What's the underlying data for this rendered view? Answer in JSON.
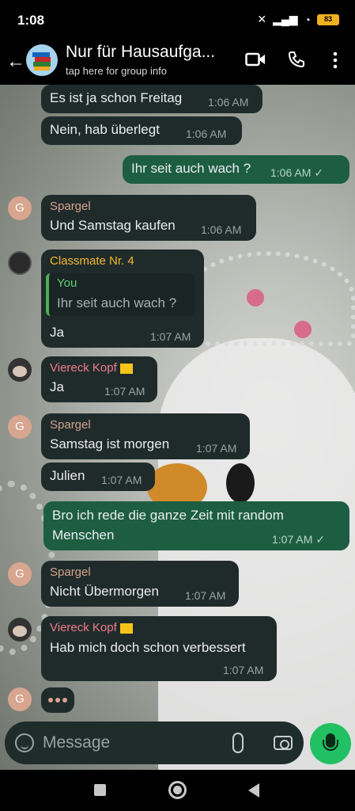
{
  "status_bar": {
    "time": "1:08",
    "battery": "83"
  },
  "header": {
    "title": "Nur für Hausaufga...",
    "subtitle": "tap here for group info"
  },
  "messages": [
    {
      "text": "Es ist ja schon Freitag",
      "time": "1:06 AM"
    },
    {
      "text": "Nein, hab überlegt",
      "time": "1:06 AM"
    },
    {
      "text": "Ihr seit auch wach ?",
      "time": "1:06 AM"
    },
    {
      "sender": "Spargel",
      "avatar": "G",
      "text": "Und Samstag kaufen",
      "time": "1:06 AM"
    },
    {
      "sender": "Classmate Nr. 4",
      "quote_author": "You",
      "quote_text": "Ihr seit auch wach ?",
      "text": "Ja",
      "time": "1:07 AM"
    },
    {
      "sender": "Viereck Kopf",
      "text": "Ja",
      "time": "1:07 AM"
    },
    {
      "sender": "Spargel",
      "avatar": "G",
      "text": "Samstag ist morgen",
      "time": "1:07 AM"
    },
    {
      "text": "Julien",
      "time": "1:07 AM"
    },
    {
      "text_line1": "Bro ich rede die ganze Zeit mit random",
      "text_line2": "Menschen",
      "time": "1:07 AM"
    },
    {
      "sender": "Spargel",
      "avatar": "G",
      "text": "Nicht Übermorgen",
      "time": "1:07 AM"
    },
    {
      "sender": "Viereck Kopf",
      "text": "Hab mich doch schon verbessert",
      "time": "1:07 AM"
    }
  ],
  "typing_avatar": "G",
  "input": {
    "placeholder": "Message"
  },
  "colors": {
    "incoming": "#1f2b2b",
    "outgoing": "#1d5e42",
    "accent": "#21c063"
  }
}
